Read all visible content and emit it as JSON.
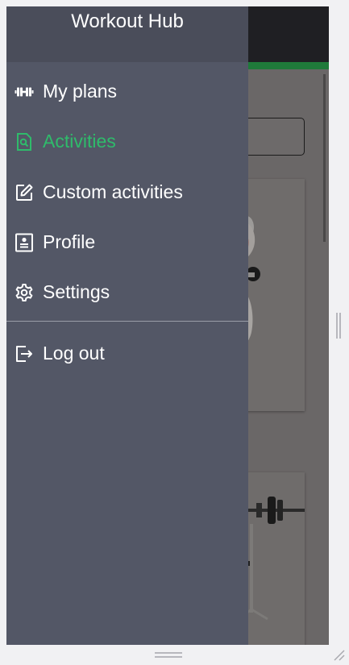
{
  "app": {
    "title": "Workout Hub"
  },
  "colors": {
    "accent": "#2fbb6b",
    "drawer": "#535766",
    "drawer_header": "#4a4d5a",
    "appbar": "#1f1f23",
    "appbar_accent": "#1f7a3a"
  },
  "nav": {
    "items": [
      {
        "label": "My plans",
        "icon": "dumbbell-icon",
        "active": false
      },
      {
        "label": "Activities",
        "icon": "search-document-icon",
        "active": true
      },
      {
        "label": "Custom activities",
        "icon": "edit-icon",
        "active": false
      },
      {
        "label": "Profile",
        "icon": "profile-card-icon",
        "active": false
      },
      {
        "label": "Settings",
        "icon": "gear-icon",
        "active": false
      }
    ],
    "logout": {
      "label": "Log out",
      "icon": "logout-icon"
    }
  }
}
